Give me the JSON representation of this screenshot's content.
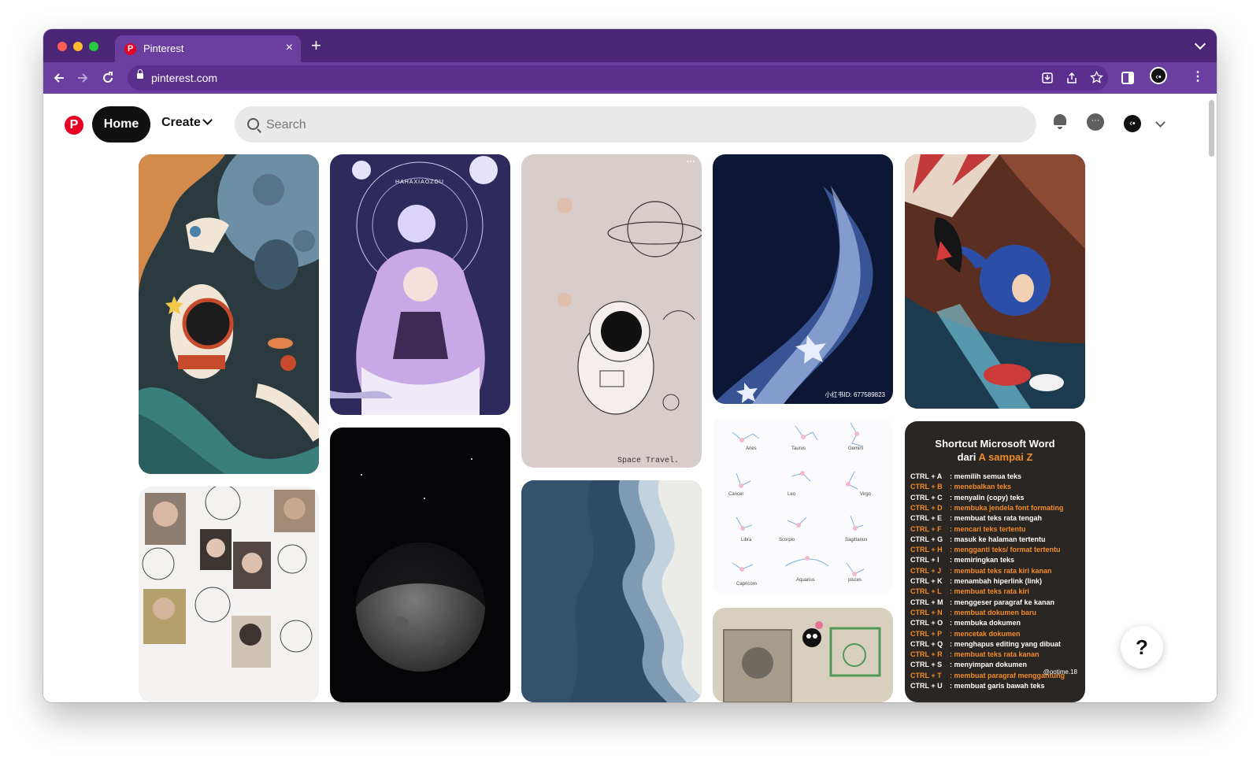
{
  "browser": {
    "tab_title": "Pinterest",
    "tab_favicon": "P",
    "tab_close": "×",
    "new_tab": "+",
    "url": "pinterest.com",
    "colors": {
      "tabbar": "#4b2576",
      "toolbar": "#6b3fa0"
    }
  },
  "header": {
    "logo": "P",
    "home_label": "Home",
    "create_label": "Create",
    "search_placeholder": "Search",
    "avatar_glyph": "‹•"
  },
  "pins": {
    "pin3_label": "Space Travel.",
    "pin4_watermark": "小红书ID: 677589823",
    "zodiac": [
      "Aries",
      "Taurus",
      "Gemini",
      "Cancer",
      "Leo",
      "Virgo",
      "Libra",
      "Scorpio",
      "Sagittarius",
      "Capricorn",
      "Aquarius",
      "pisces"
    ],
    "word_title_1": "Shortcut Microsoft Word",
    "word_title_2a": "dari ",
    "word_title_2b": "A sampai Z",
    "word_shortcuts": [
      {
        "key": "CTRL + A",
        "desc": ": memilih semua teks",
        "hl": false
      },
      {
        "key": "CTRL + B",
        "desc": ": menebalkan teks",
        "hl": true
      },
      {
        "key": "CTRL + C",
        "desc": ": menyalin (copy) teks",
        "hl": false
      },
      {
        "key": "CTRL + D",
        "desc": ": membuka jendela font formating",
        "hl": true
      },
      {
        "key": "CTRL + E",
        "desc": ": membuat teks rata tengah",
        "hl": false
      },
      {
        "key": "CTRL + F",
        "desc": ": mencari teks tertentu",
        "hl": true
      },
      {
        "key": "CTRL + G",
        "desc": ": masuk ke halaman tertentu",
        "hl": false
      },
      {
        "key": "CTRL + H",
        "desc": ": mengganti teks/ format tertentu",
        "hl": true
      },
      {
        "key": "CTRL + I",
        "desc": ": memiringkan teks",
        "hl": false
      },
      {
        "key": "CTRL + J",
        "desc": ": membuat teks rata kiri kanan",
        "hl": true
      },
      {
        "key": "CTRL + K",
        "desc": ": menambah hiperlink (link)",
        "hl": false
      },
      {
        "key": "CTRL + L",
        "desc": ": membuat teks rata kiri",
        "hl": true
      },
      {
        "key": "CTRL + M",
        "desc": ": menggeser paragraf ke kanan",
        "hl": false
      },
      {
        "key": "CTRL + N",
        "desc": ": membuat dokumen baru",
        "hl": true
      },
      {
        "key": "CTRL + O",
        "desc": ": membuka dokumen",
        "hl": false
      },
      {
        "key": "CTRL + P",
        "desc": ": mencetak dokumen",
        "hl": true
      },
      {
        "key": "CTRL + Q",
        "desc": ": menghapus editing yang dibuat",
        "hl": false
      },
      {
        "key": "CTRL + R",
        "desc": ": membuat teks rata kanan",
        "hl": true
      },
      {
        "key": "CTRL + S",
        "desc": ": menyimpan dokumen",
        "hl": false
      },
      {
        "key": "CTRL + T",
        "desc": ": membuat paragraf menggantung",
        "hl": true
      },
      {
        "key": "CTRL + U",
        "desc": ": membuat garis bawah teks",
        "hl": false
      }
    ],
    "word_credit": "@ootime.18"
  },
  "help_label": "?"
}
